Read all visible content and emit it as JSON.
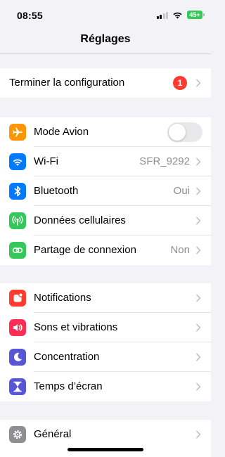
{
  "status_bar": {
    "time": "08:55",
    "battery": "45+"
  },
  "nav": {
    "title": "Réglages"
  },
  "setup": {
    "label": "Terminer la configuration",
    "badge": "1"
  },
  "network": [
    {
      "label": "Mode Avion",
      "icon": "airplane-icon",
      "color": "#ff9500",
      "toggle": false
    },
    {
      "label": "Wi-Fi",
      "value": "SFR_9292",
      "icon": "wifi-icon",
      "color": "#007aff"
    },
    {
      "label": "Bluetooth",
      "value": "Oui",
      "icon": "bluetooth-icon",
      "color": "#007aff"
    },
    {
      "label": "Données cellulaires",
      "icon": "cellular-icon",
      "color": "#34c759"
    },
    {
      "label": "Partage de connexion",
      "value": "Non",
      "icon": "hotspot-icon",
      "color": "#34c759"
    }
  ],
  "notifications": [
    {
      "label": "Notifications",
      "icon": "notifications-icon",
      "color": "#ff3b30"
    },
    {
      "label": "Sons et vibrations",
      "icon": "sound-icon",
      "color": "#ff2d55"
    },
    {
      "label": "Concentration",
      "icon": "moon-icon",
      "color": "#5856d6"
    },
    {
      "label": "Temps d’écran",
      "icon": "hourglass-icon",
      "color": "#5856d6"
    }
  ],
  "general": [
    {
      "label": "Général",
      "icon": "gear-icon",
      "color": "#8e8e93"
    }
  ]
}
